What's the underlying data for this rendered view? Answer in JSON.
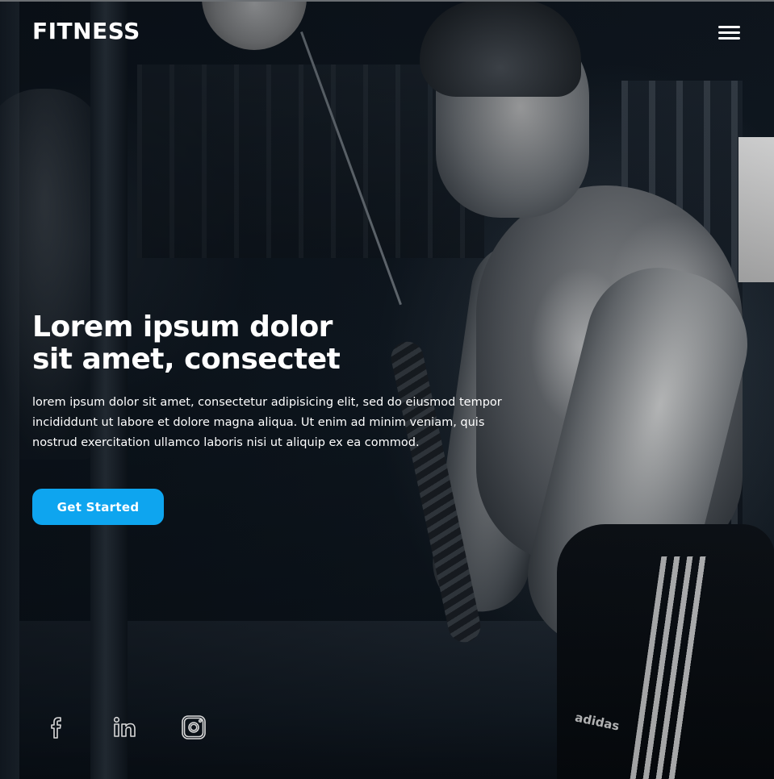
{
  "header": {
    "brand": "FITNESS",
    "menu_icon": "hamburger-menu-icon"
  },
  "hero": {
    "title_line1": "Lorem ipsum dolor",
    "title_line2": "sit amet, consectet",
    "description": "lorem ipsum dolor sit amet, consectetur adipisicing elit, sed do eiusmod tempor incididdunt ut labore et dolore magna aliqua. Ut enim ad minim veniam, quis nostrud exercitation ullamco laboris nisi ut aliquip ex ea commod.",
    "cta_label": "Get Started"
  },
  "social": [
    {
      "icon": "facebook-icon"
    },
    {
      "icon": "linkedin-icon"
    },
    {
      "icon": "instagram-icon"
    }
  ],
  "colors": {
    "accent": "#0ea5ef",
    "text": "#ffffff",
    "background": "#0b1119"
  }
}
